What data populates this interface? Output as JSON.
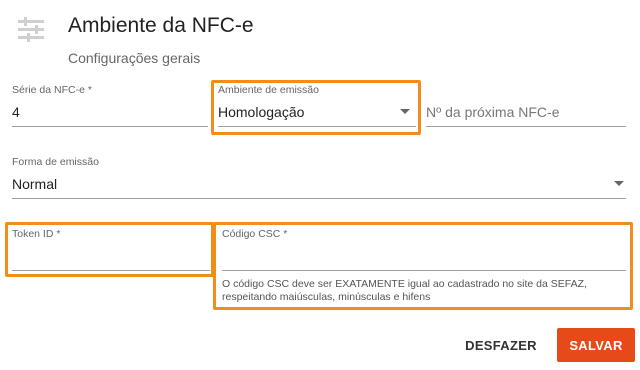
{
  "header": {
    "icon": "sliders-icon",
    "title": "Ambiente da NFC-e",
    "subtitle": "Configurações gerais"
  },
  "fields": {
    "serie": {
      "label": "Série da NFC-e *",
      "value": "4"
    },
    "ambiente": {
      "label": "Ambiente de emissão",
      "value": "Homologação"
    },
    "proxima": {
      "placeholder": "Nº da próxima NFC-e"
    },
    "forma": {
      "label": "Forma de emissão",
      "value": "Normal"
    },
    "token": {
      "label": "Token ID *",
      "value": ""
    },
    "csc": {
      "label": "Código CSC *",
      "value": "",
      "hint_line1": "O código CSC deve ser EXATAMENTE igual ao cadastrado no site da SEFAZ,",
      "hint_line2": "respeitando maiúsculas, minúsculas e hifens"
    }
  },
  "actions": {
    "undo_label": "DESFAZER",
    "save_label": "SALVAR"
  },
  "colors": {
    "highlight": "#f28c1b",
    "save_button": "#e64a19"
  }
}
